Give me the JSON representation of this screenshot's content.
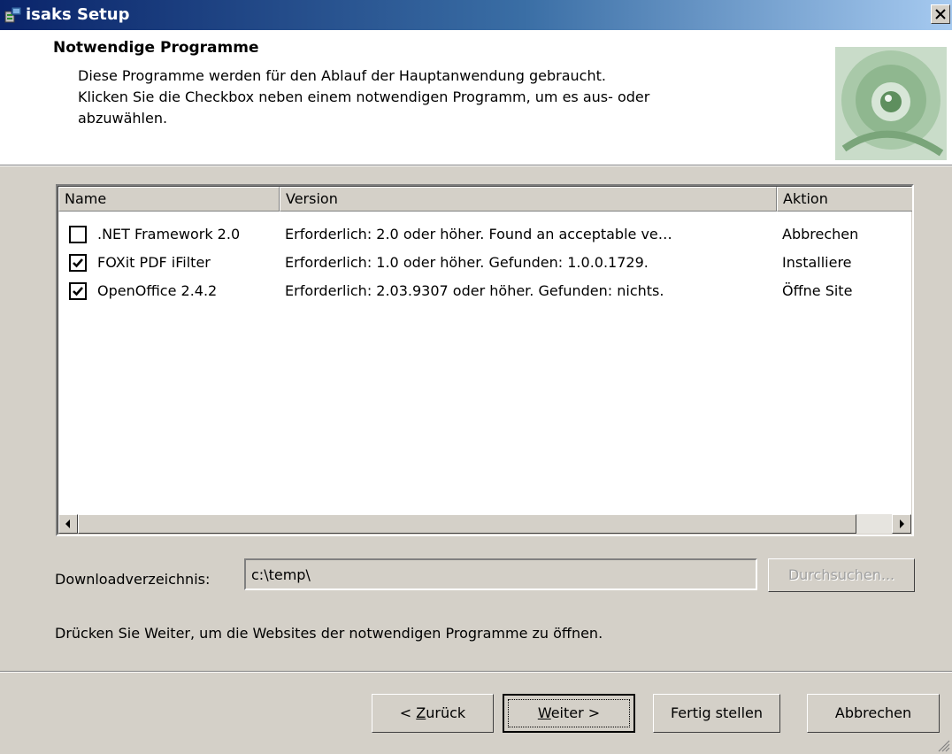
{
  "window": {
    "title": "isaks Setup"
  },
  "header": {
    "title": "Notwendige Programme",
    "description": "Diese Programme werden für den Ablauf der Hauptanwendung gebraucht.\nKlicken Sie die Checkbox neben einem notwendigen Programm, um es aus- oder\nabzuwählen."
  },
  "table": {
    "columns": [
      "Name",
      "Version",
      "Aktion"
    ],
    "rows": [
      {
        "checked": false,
        "name": ".NET Framework 2.0",
        "version": "Erforderlich: 2.0 oder höher. Found an acceptable ve…",
        "action": "Abbrechen"
      },
      {
        "checked": true,
        "name": "FOXit PDF iFilter",
        "version": "Erforderlich: 1.0 oder höher. Gefunden: 1.0.0.1729.",
        "action": "Installiere"
      },
      {
        "checked": true,
        "name": "OpenOffice 2.4.2",
        "version": "Erforderlich: 2.03.9307 oder höher. Gefunden: nichts.",
        "action": "Öffne Site"
      }
    ]
  },
  "download": {
    "label": "Downloadverzeichnis:",
    "value": "c:\\temp\\",
    "browse_label": "Durchsuchen..."
  },
  "hint": "Drücken Sie Weiter, um die Websites der notwendigen Programme zu öffnen.",
  "buttons": {
    "back_prefix": "< ",
    "back_mnemonic": "Z",
    "back_rest": "urück",
    "next_mnemonic": "W",
    "next_rest": "eiter >",
    "finish": "Fertig stellen",
    "cancel": "Abbrechen"
  }
}
